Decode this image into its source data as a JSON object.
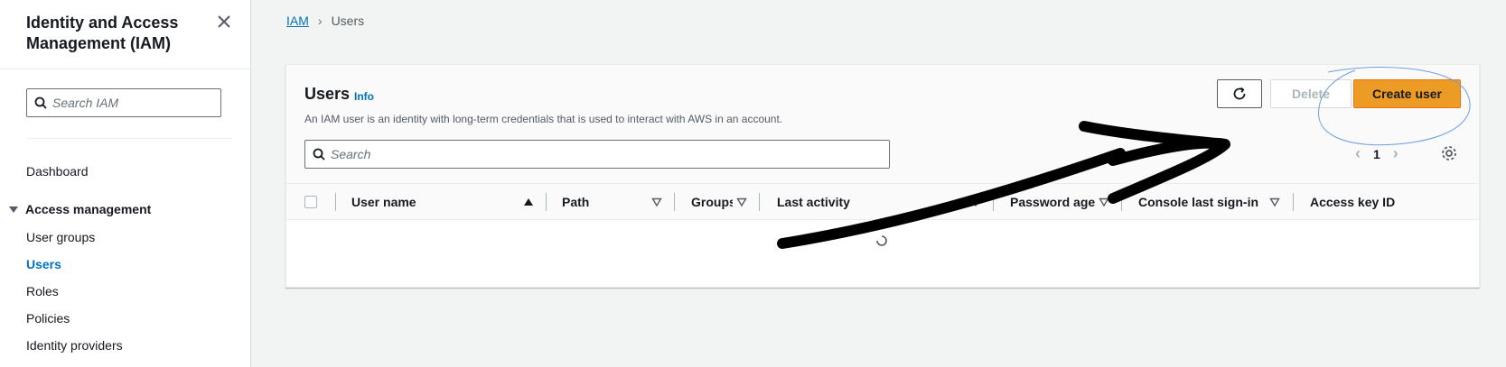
{
  "sidebar": {
    "title": "Identity and Access Management (IAM)",
    "search_placeholder": "Search IAM",
    "dashboard": "Dashboard",
    "section": "Access management",
    "items": [
      {
        "label": "User groups"
      },
      {
        "label": "Users"
      },
      {
        "label": "Roles"
      },
      {
        "label": "Policies"
      },
      {
        "label": "Identity providers"
      }
    ]
  },
  "breadcrumb": {
    "root": "IAM",
    "current": "Users"
  },
  "panel": {
    "title": "Users",
    "info": "Info",
    "description": "An IAM user is an identity with long-term credentials that is used to interact with AWS in an account.",
    "delete_label": "Delete",
    "create_label": "Create user",
    "search_placeholder": "Search",
    "page": "1"
  },
  "table": {
    "columns": [
      "User name",
      "Path",
      "Groups",
      "Last activity",
      "Password age",
      "Console last sign-in",
      "Access key ID"
    ]
  },
  "colors": {
    "accent": "#ec9b24",
    "link": "#0073bb"
  }
}
